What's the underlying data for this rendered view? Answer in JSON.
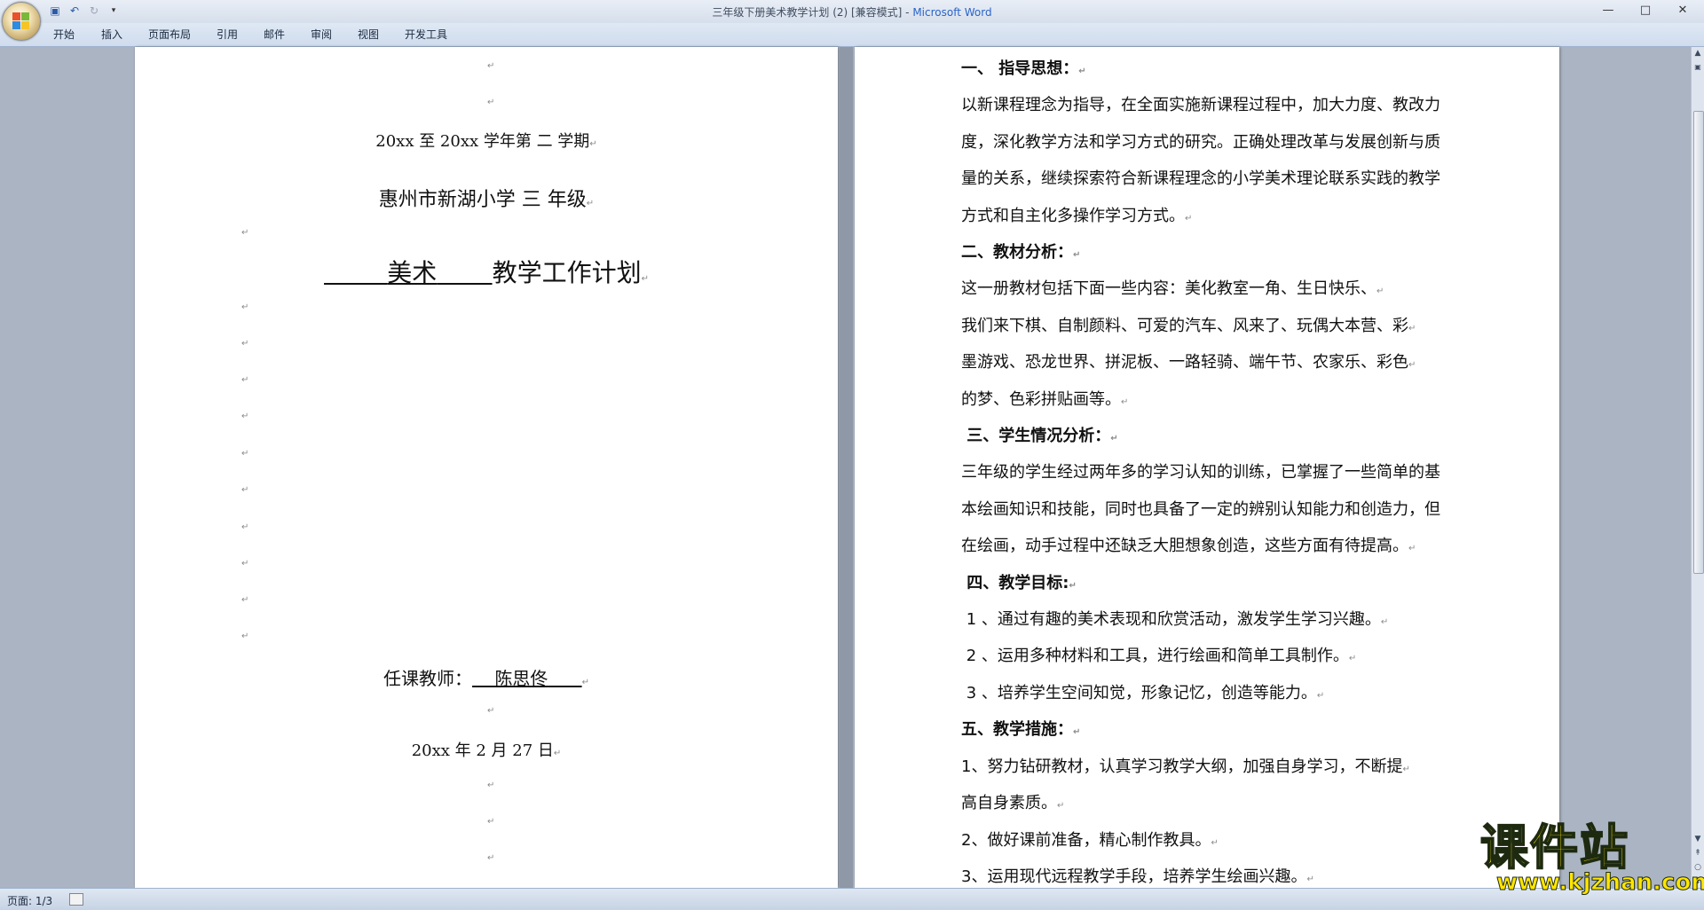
{
  "window": {
    "title_prefix": "三年级下册美术教学计划 (2) [兼容模式] - ",
    "title_app": "Microsoft Word"
  },
  "window_controls": {
    "minimize": "—",
    "maximize": "□",
    "close": "✕"
  },
  "ribbon": {
    "tabs": [
      "开始",
      "插入",
      "页面布局",
      "引用",
      "邮件",
      "审阅",
      "视图",
      "开发工具"
    ]
  },
  "paragraph_mark": "↵",
  "left_page": {
    "term": "20xx  至 20xx    学年第  二  学期",
    "school": "惠州市新湖小学    三    年级",
    "plan_blank_left": "        ",
    "plan_subject": "美术",
    "plan_blank_right": "       ",
    "plan_title": "教学工作计划",
    "teacher_label": "任课教师：",
    "teacher_name": "陈思佟",
    "date": "20xx    年 2 月 27 日"
  },
  "right_page": {
    "lines": [
      "一、  指导思想：",
      "以新课程理念为指导，在全面实施新课程过程中，加大力度、教改力",
      "度，深化教学方法和学习方式的研究。正确处理改革与发展创新与质",
      "量的关系，继续探索符合新课程理念的小学美术理论联系实践的教学",
      "方式和自主化多操作学习方式。",
      "二、教材分析：",
      "这一册教材包括下面一些内容：美化教室一角、生日快乐、",
      "我们来下棋、自制颜料、可爱的汽车、风来了、玩偶大本营、彩",
      "墨游戏、恐龙世界、拼泥板、一路轻骑、端午节、农家乐、彩色",
      "的梦、色彩拼贴画等。",
      " 三、学生情况分析：",
      "三年级的学生经过两年多的学习认知的训练，已掌握了一些简单的基",
      "本绘画知识和技能，同时也具备了一定的辨别认知能力和创造力，但",
      "在绘画，动手过程中还缺乏大胆想象创造，这些方面有待提高。",
      " 四、教学目标:",
      " 1 、通过有趣的美术表现和欣赏活动，激发学生学习兴趣。",
      " 2 、运用多种材料和工具，进行绘画和简单工具制作。",
      " 3 、培养学生空间知觉，形象记忆，创造等能力。",
      "五、教学措施：",
      "1、努力钻研教材，认真学习教学大纲，加强自身学习，不断提",
      "高自身素质。",
      "2、做好课前准备，精心制作教具。",
      "3、运用现代远程教学手段，培养学生绘画兴趣。"
    ]
  },
  "statusbar": {
    "page": "页面: 1/3"
  },
  "watermark": {
    "text": "课件站",
    "url": "www.kjzhan.com"
  }
}
